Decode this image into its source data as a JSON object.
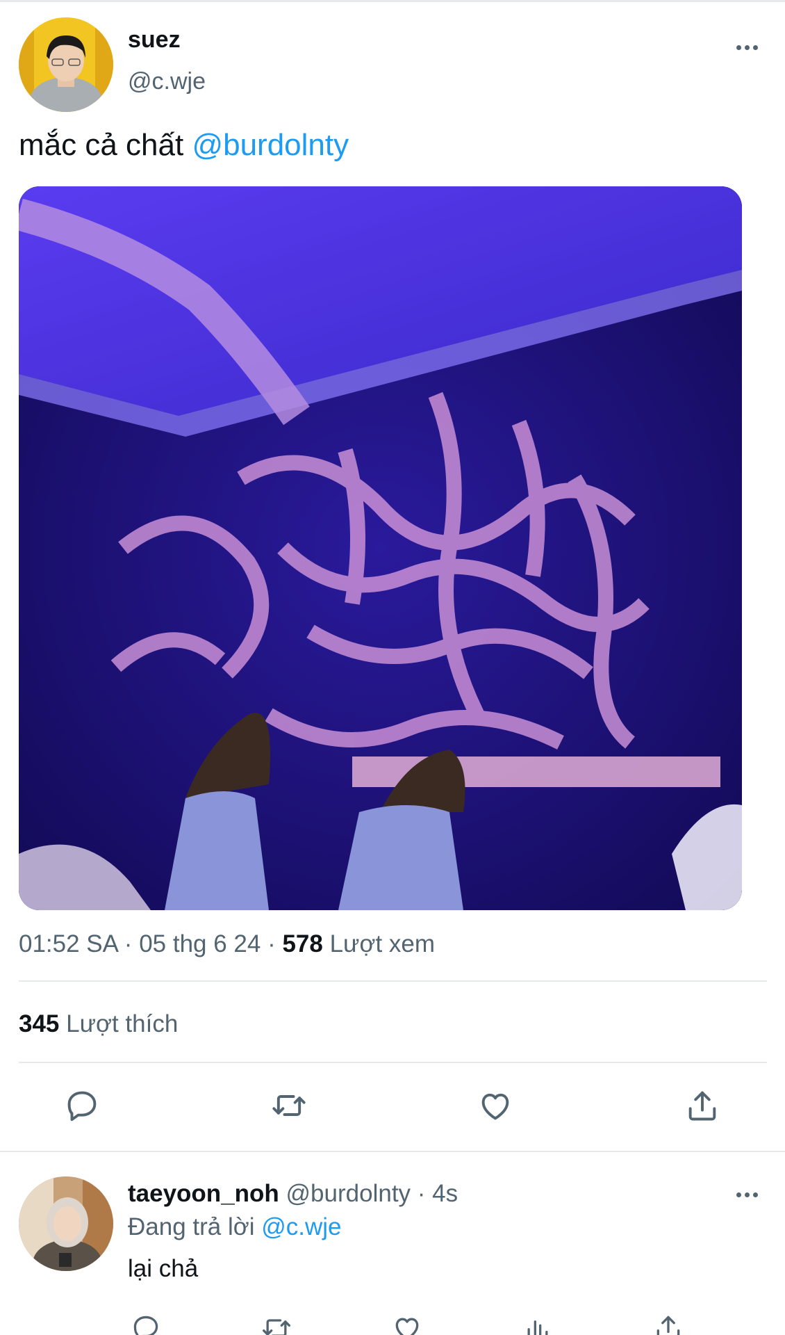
{
  "tweet": {
    "author_name": "suez",
    "author_handle": "@c.wje",
    "text": "mắc cả chất ",
    "mention": "@burdolnty",
    "time": "01:52 SA",
    "date": "05 thg 6 24",
    "views_count": "578",
    "views_label": "Lượt xem",
    "likes_count": "345",
    "likes_label": "Lượt thích",
    "separator": " · "
  },
  "reply": {
    "author_name": "taeyoon_noh",
    "author_handle": "@burdolnty",
    "age": "· 4s",
    "replying_label": "Đang trả lời ",
    "replying_to": "@c.wje",
    "text": "lại chả"
  },
  "colors": {
    "link": "#1d9bf0",
    "secondary_text": "#536471",
    "icon": "#536471",
    "divider": "#e6e9ec"
  },
  "icons": {
    "actions": [
      "reply-icon",
      "retweet-icon",
      "like-icon",
      "share-icon"
    ],
    "reply_actions": [
      "reply-icon",
      "retweet-icon",
      "like-icon",
      "analytics-icon",
      "share-icon"
    ],
    "more": "more-options-icon"
  }
}
